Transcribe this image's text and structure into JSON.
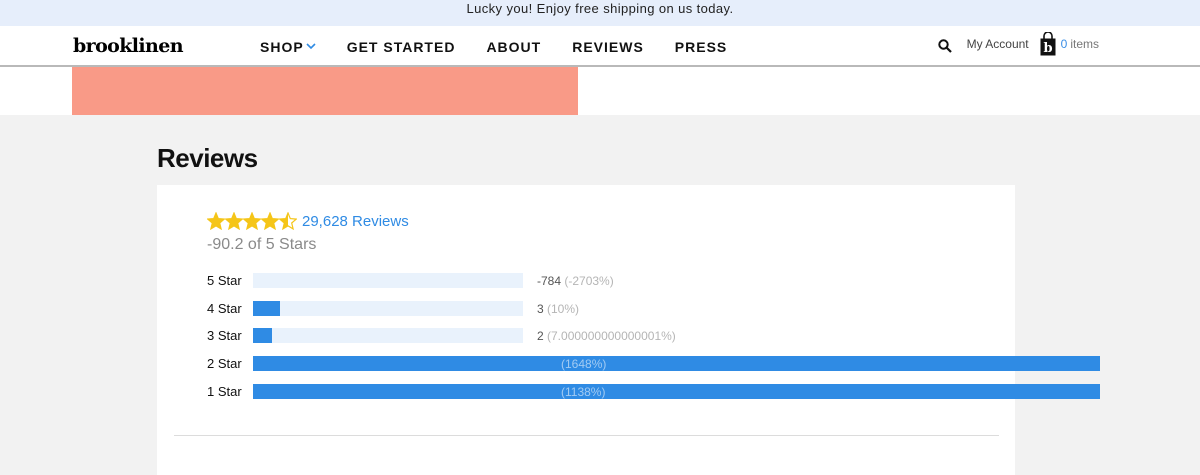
{
  "promo": {
    "text": "Lucky you! Enjoy free shipping on us today."
  },
  "brand": {
    "logo": "brooklinen"
  },
  "nav": {
    "links": [
      {
        "label": "SHOP",
        "dropdown": true
      },
      {
        "label": "GET STARTED"
      },
      {
        "label": "ABOUT"
      },
      {
        "label": "REVIEWS"
      },
      {
        "label": "PRESS"
      }
    ],
    "account_label": "My Account",
    "cart_count": "0",
    "cart_label": "items"
  },
  "colors": {
    "promo_bg": "#e6eefb",
    "hero": "#f99a87",
    "accent": "#2f8be4",
    "star": "#f5c518",
    "track": "#e9f2fc"
  },
  "reviews": {
    "heading": "Reviews",
    "star_rating": 4.5,
    "count_label": "29,628 Reviews",
    "average_label": "-90.2 of 5 Stars",
    "distribution": [
      {
        "label": "5 Star",
        "count": "-784",
        "pct": "(-2703%)",
        "fill": 0
      },
      {
        "label": "4 Star",
        "count": "3",
        "pct": "(10%)",
        "fill": 0.1
      },
      {
        "label": "3 Star",
        "count": "2",
        "pct": "(7.000000000000001%)",
        "fill": 0.07
      },
      {
        "label": "2 Star",
        "count": "",
        "pct": "(1648%)",
        "fill": 16.48
      },
      {
        "label": "1 Star",
        "count": "",
        "pct": "(1138%)",
        "fill": 11.38
      }
    ]
  }
}
